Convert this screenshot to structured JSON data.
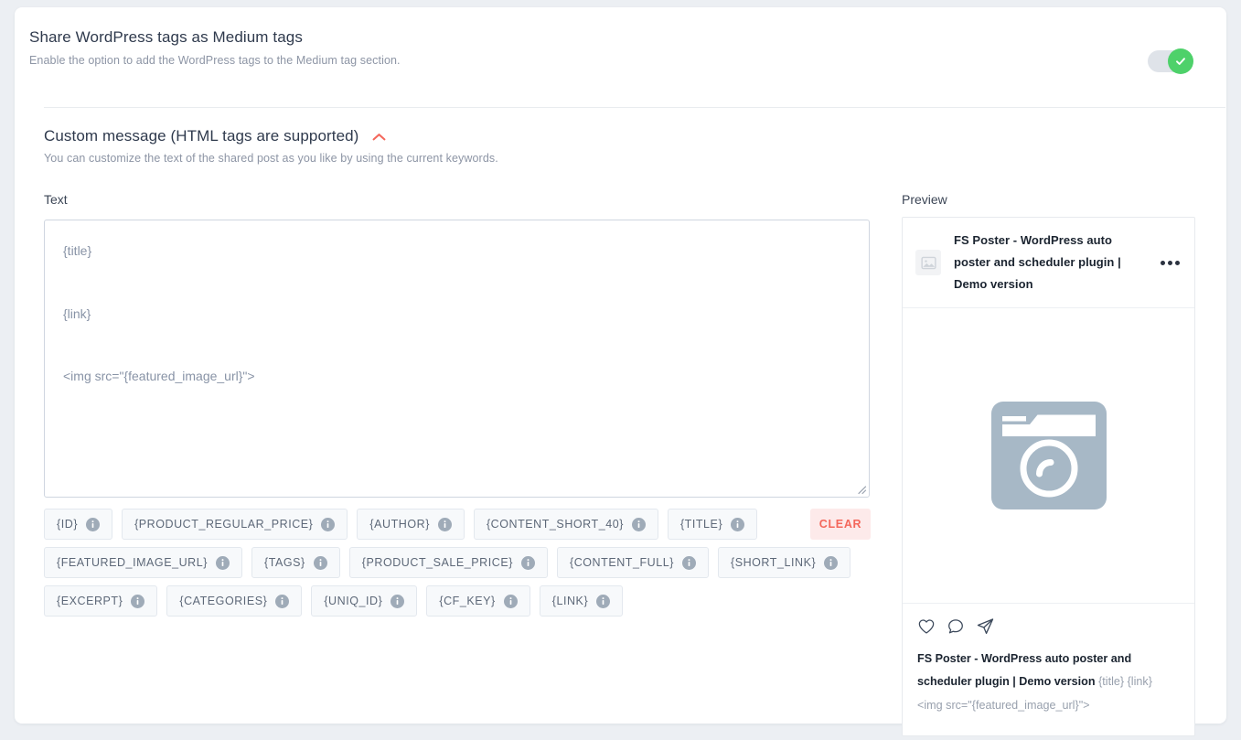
{
  "share_section": {
    "title": "Share WordPress tags as Medium tags",
    "subtitle": "Enable the option to add the WordPress tags to the Medium tag section.",
    "toggle_state": "on",
    "toggle_color": "#4ed16a"
  },
  "custom_message": {
    "title": "Custom message (HTML tags are supported)",
    "subtitle": "You can customize the text of the shared post as you like by using the current keywords.",
    "collapse_icon": "chevron-up-icon",
    "collapse_color": "#f4675b",
    "text_label": "Text",
    "preview_label": "Preview",
    "textarea_value": "{title}\n\n{link}\n\n<img src=\"{featured_image_url}\">",
    "clear_label": "CLEAR",
    "clear_bg": "#fdeaea",
    "clear_color": "#f4675b"
  },
  "keywords": [
    {
      "label": "{ID}"
    },
    {
      "label": "{PRODUCT_REGULAR_PRICE}"
    },
    {
      "label": "{AUTHOR}"
    },
    {
      "label": "{CONTENT_SHORT_40}"
    },
    {
      "label": "{TITLE}"
    },
    {
      "label": "{FEATURED_IMAGE_URL}"
    },
    {
      "label": "{TAGS}"
    },
    {
      "label": "{PRODUCT_SALE_PRICE}"
    },
    {
      "label": "{CONTENT_FULL}"
    },
    {
      "label": "{SHORT_LINK}"
    },
    {
      "label": "{EXCERPT}"
    },
    {
      "label": "{CATEGORIES}"
    },
    {
      "label": "{UNIQ_ID}"
    },
    {
      "label": "{CF_KEY}"
    },
    {
      "label": "{LINK}"
    }
  ],
  "preview": {
    "account_name": "FS Poster - WordPress auto poster and scheduler plugin | Demo version",
    "avatar_icon": "broken-image-icon",
    "menu_icon": "more-options-icon",
    "media_icon": "camera-placeholder-icon",
    "media_color": "#a7b8c6",
    "actions": [
      "heart-icon",
      "comment-icon",
      "send-icon"
    ],
    "caption_author": "FS Poster - WordPress auto poster and scheduler plugin | Demo version",
    "caption_body": "{title} {link} <img src=\"{featured_image_url}\">"
  }
}
